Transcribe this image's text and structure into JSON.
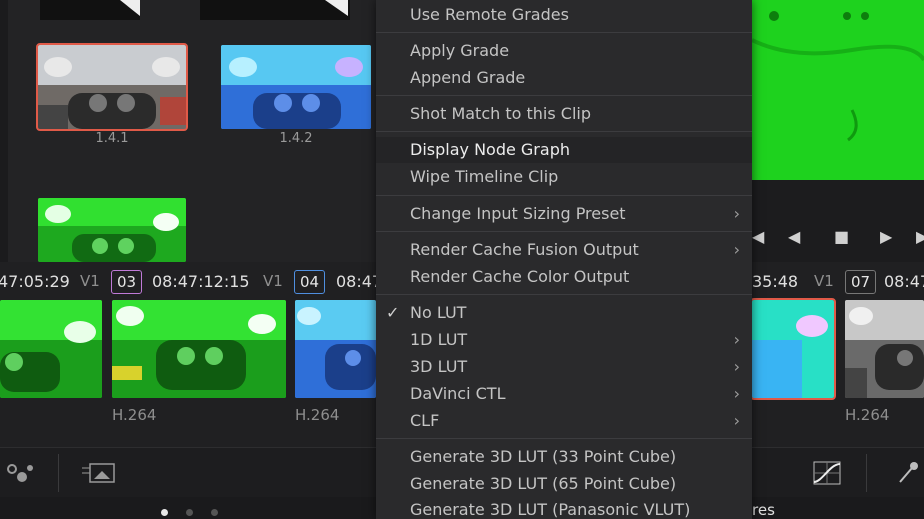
{
  "gallery": {
    "stills": [
      {
        "label": "1.4.1"
      },
      {
        "label": "1.4.2"
      },
      {
        "label": ""
      }
    ]
  },
  "timeline": {
    "timecodes": [
      "47:05:29",
      "08:47:12:15",
      "08:47",
      "35:48",
      "08:47"
    ],
    "tracks": [
      "V1",
      "V1",
      "V1"
    ],
    "clip_numbers": [
      "03",
      "04",
      "07"
    ],
    "codecs": [
      "H.264",
      "H.264",
      "H.264"
    ]
  },
  "menu": {
    "items": [
      {
        "label": "Use Remote Grades"
      },
      {
        "label": "Apply Grade"
      },
      {
        "label": "Append Grade"
      },
      {
        "label": "Shot Match to this Clip"
      },
      {
        "label": "Display Node Graph"
      },
      {
        "label": "Wipe Timeline Clip"
      },
      {
        "label": "Change Input Sizing Preset"
      },
      {
        "label": "Render Cache Fusion Output"
      },
      {
        "label": "Render Cache Color Output"
      },
      {
        "label": "No LUT"
      },
      {
        "label": "1D LUT"
      },
      {
        "label": "3D LUT"
      },
      {
        "label": "DaVinci CTL"
      },
      {
        "label": "CLF"
      },
      {
        "label": "Generate 3D LUT (33 Point Cube)"
      },
      {
        "label": "Generate 3D LUT (65 Point Cube)"
      },
      {
        "label": "Generate 3D LUT (Panasonic VLUT)"
      }
    ],
    "submenu_glyph": "›",
    "check_glyph": "✓"
  },
  "transport": {
    "prev": "◀",
    "stop": "■",
    "play": "▶"
  },
  "partial_label": "res",
  "colors": {
    "selected_outline": "#e05a48",
    "menu_bg": "#2a2a2c",
    "clip03_border": "#c07ad8",
    "clip04_border": "#4f8fe0"
  }
}
